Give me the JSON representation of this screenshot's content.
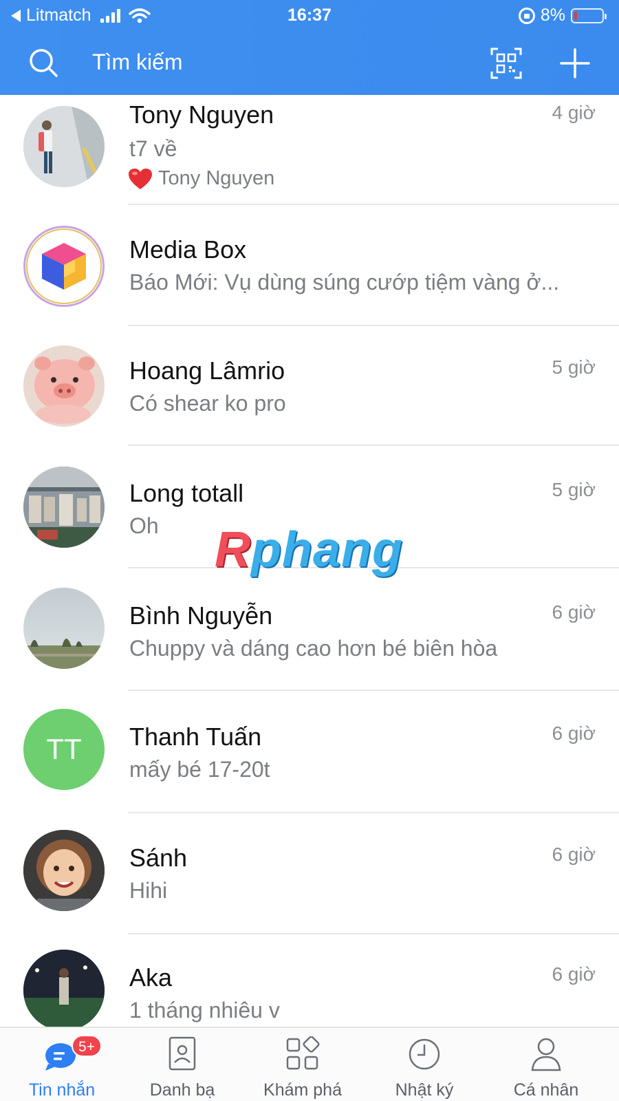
{
  "status_bar": {
    "back_app": "Litmatch",
    "time": "16:37",
    "battery": "8%"
  },
  "header": {
    "search_placeholder": "Tìm kiếm"
  },
  "colors": {
    "header_bg": "#3f8ff0",
    "accent": "#2d7ff3",
    "badge": "#f1434b",
    "avatar_tt": "#6dcf6f"
  },
  "chats": [
    {
      "name": "Tony Nguyen",
      "preview": "t7 về",
      "sub": "Tony Nguyen",
      "time": "4 giờ",
      "reaction_icon": "red-heart-icon"
    },
    {
      "name": "Media Box",
      "preview": "Báo Mới: Vụ dùng súng cướp tiệm vàng ở...",
      "time": ""
    },
    {
      "name": "Hoang Lâmrio",
      "preview": "Có shear  ko pro",
      "time": "5 giờ"
    },
    {
      "name": "Long totall",
      "preview": "Oh",
      "time": "5 giờ"
    },
    {
      "name": "Bình Nguyễn",
      "preview": "Chuppy và dáng cao hơn bé biên hòa",
      "time": "6 giờ"
    },
    {
      "name": "Thanh Tuấn",
      "preview": "mấy bé 17-20t",
      "time": "6 giờ",
      "initials": "TT"
    },
    {
      "name": "Sánh",
      "preview": "Hihi",
      "time": "6 giờ"
    },
    {
      "name": "Aka",
      "preview": "1 tháng nhiêu v",
      "time": "6 giờ"
    }
  ],
  "watermark": {
    "first": "R",
    "rest": "phang"
  },
  "bottom_nav": [
    {
      "label": "Tin nhắn",
      "badge": "5+"
    },
    {
      "label": "Danh bạ"
    },
    {
      "label": "Khám phá"
    },
    {
      "label": "Nhật ký"
    },
    {
      "label": "Cá nhân"
    }
  ]
}
